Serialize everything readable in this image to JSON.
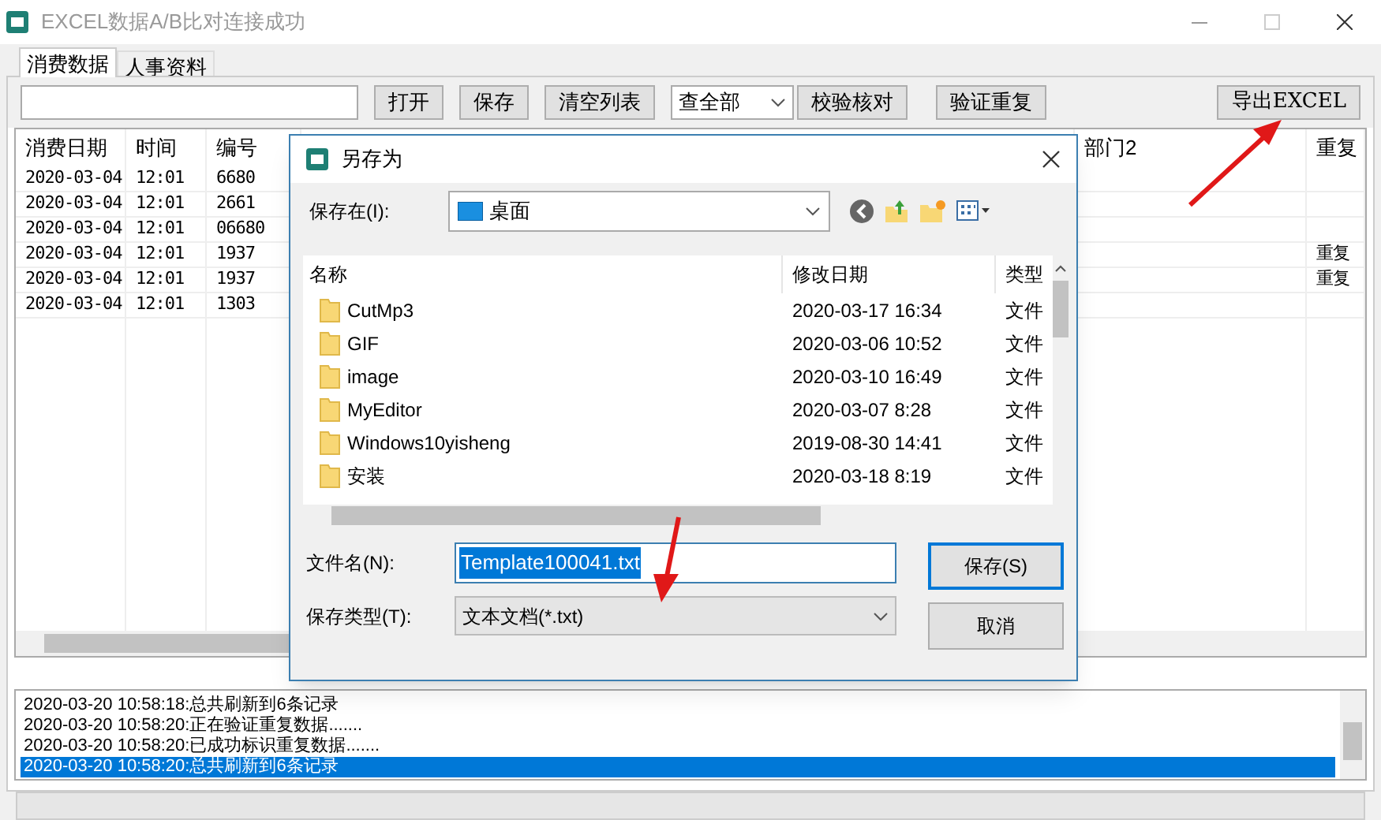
{
  "window": {
    "title": "EXCEL数据A/B比对连接成功"
  },
  "tabs": [
    {
      "label": "消费数据",
      "selected": true
    },
    {
      "label": "人事资料",
      "selected": false
    }
  ],
  "toolbar": {
    "buttons": [
      "打开",
      "保存",
      "清空列表"
    ],
    "filter": "查全部",
    "buttons_after": [
      "校验核对",
      "验证重复"
    ],
    "export": "导出EXCEL"
  },
  "table": {
    "columns": [
      "消费日期",
      "时间",
      "编号",
      "部门2",
      "重复"
    ],
    "rows": [
      [
        "2020-03-04",
        "12:01",
        "6680",
        "",
        ""
      ],
      [
        "2020-03-04",
        "12:01",
        "2661",
        "",
        ""
      ],
      [
        "2020-03-04",
        "12:01",
        "06680",
        "",
        ""
      ],
      [
        "2020-03-04",
        "12:01",
        "1937",
        "",
        "重复"
      ],
      [
        "2020-03-04",
        "12:01",
        "1937",
        "",
        "重复"
      ],
      [
        "2020-03-04",
        "12:01",
        "1303",
        "",
        ""
      ]
    ]
  },
  "dialog": {
    "title": "另存为",
    "location_label": "保存在(I):",
    "location": "桌面",
    "columns": [
      "名称",
      "修改日期",
      "类型"
    ],
    "files": [
      {
        "name": "CutMp3",
        "date": "2020-03-17 16:34",
        "type": "文件"
      },
      {
        "name": "GIF",
        "date": "2020-03-06 10:52",
        "type": "文件"
      },
      {
        "name": "image",
        "date": "2020-03-10 16:49",
        "type": "文件"
      },
      {
        "name": "MyEditor",
        "date": "2020-03-07 8:28",
        "type": "文件"
      },
      {
        "name": "Windows10yisheng",
        "date": "2019-08-30 14:41",
        "type": "文件"
      },
      {
        "name": "安装",
        "date": "2020-03-18 8:19",
        "type": "文件"
      }
    ],
    "filename_label": "文件名(N):",
    "filename": "Template100041.txt",
    "filetype_label": "保存类型(T):",
    "filetype": "文本文档(*.txt)",
    "save": "保存(S)",
    "cancel": "取消"
  },
  "log": [
    {
      "text": "2020-03-20 10:58:18:总共刷新到6条记录",
      "selected": false
    },
    {
      "text": "2020-03-20 10:58:20:正在验证重复数据.......",
      "selected": false
    },
    {
      "text": "2020-03-20 10:58:20:已成功标识重复数据.......",
      "selected": false
    },
    {
      "text": "2020-03-20 10:58:20:总共刷新到6条记录",
      "selected": true
    }
  ]
}
